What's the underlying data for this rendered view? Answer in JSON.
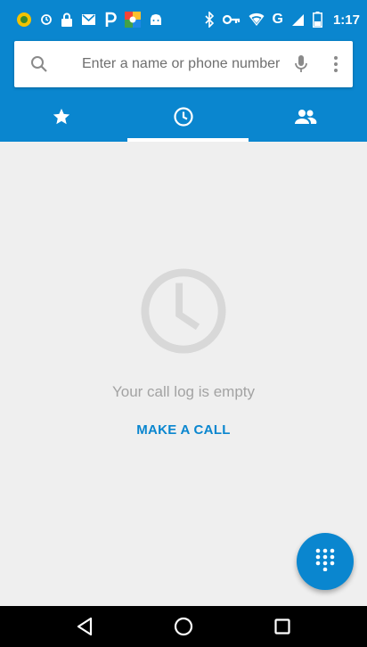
{
  "status_bar": {
    "time": "1:17",
    "network": "G",
    "left_icons": [
      "notification-icon",
      "sync-icon",
      "lock-icon",
      "mail-icon",
      "pinterest-icon",
      "photos-icon",
      "android-icon"
    ],
    "right_icons": [
      "bluetooth-icon",
      "key-icon",
      "wifi-icon",
      "signal-icon",
      "battery-icon"
    ]
  },
  "search": {
    "placeholder": "Enter a name or phone number"
  },
  "tabs": [
    {
      "name": "favorites",
      "icon": "star-icon",
      "selected": false
    },
    {
      "name": "recents",
      "icon": "clock-icon",
      "selected": true
    },
    {
      "name": "contacts",
      "icon": "people-icon",
      "selected": false
    }
  ],
  "empty_state": {
    "message": "Your call log is empty",
    "action_label": "MAKE A CALL"
  },
  "fab": {
    "icon": "dialpad-icon"
  },
  "nav_bar": {
    "buttons": [
      "back-icon",
      "home-icon",
      "recents-icon"
    ]
  },
  "colors": {
    "primary": "#0a86cf",
    "background": "#efefef",
    "empty_text": "#a3a3a3",
    "placeholder": "#6f6f6f"
  }
}
